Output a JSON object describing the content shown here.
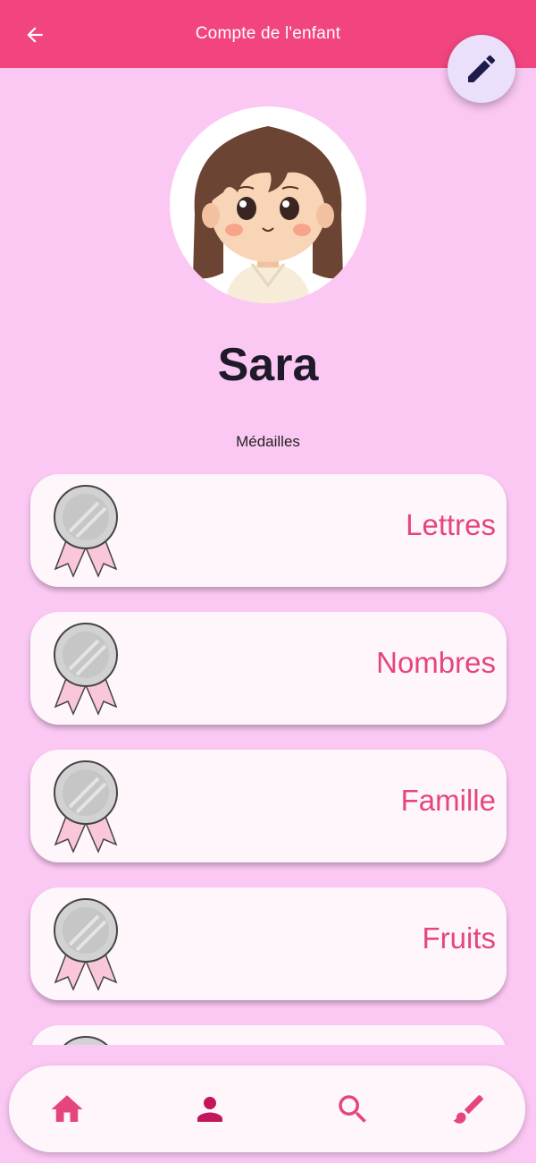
{
  "appbar": {
    "title": "Compte de l'enfant",
    "back_icon": "arrow-left-icon",
    "color": "#f2457f"
  },
  "edit_button": {
    "icon": "pencil-icon"
  },
  "profile": {
    "name": "Sara",
    "avatar": "girl-avatar"
  },
  "medals": {
    "section_label": "Médailles",
    "items": [
      {
        "label": "Lettres",
        "icon": "silver-medal-icon"
      },
      {
        "label": "Nombres",
        "icon": "silver-medal-icon"
      },
      {
        "label": "Famille",
        "icon": "silver-medal-icon"
      },
      {
        "label": "Fruits",
        "icon": "silver-medal-icon"
      },
      {
        "label": "",
        "icon": "silver-medal-icon"
      }
    ]
  },
  "bottom_nav": {
    "items": [
      {
        "icon": "home-icon",
        "active": false
      },
      {
        "icon": "person-icon",
        "active": true
      },
      {
        "icon": "search-icon",
        "active": false
      },
      {
        "icon": "brush-icon",
        "active": false
      }
    ]
  },
  "colors": {
    "background": "#fbc8f3",
    "accent": "#e5457f",
    "active_nav": "#c2185b",
    "card": "#fff6fc"
  }
}
